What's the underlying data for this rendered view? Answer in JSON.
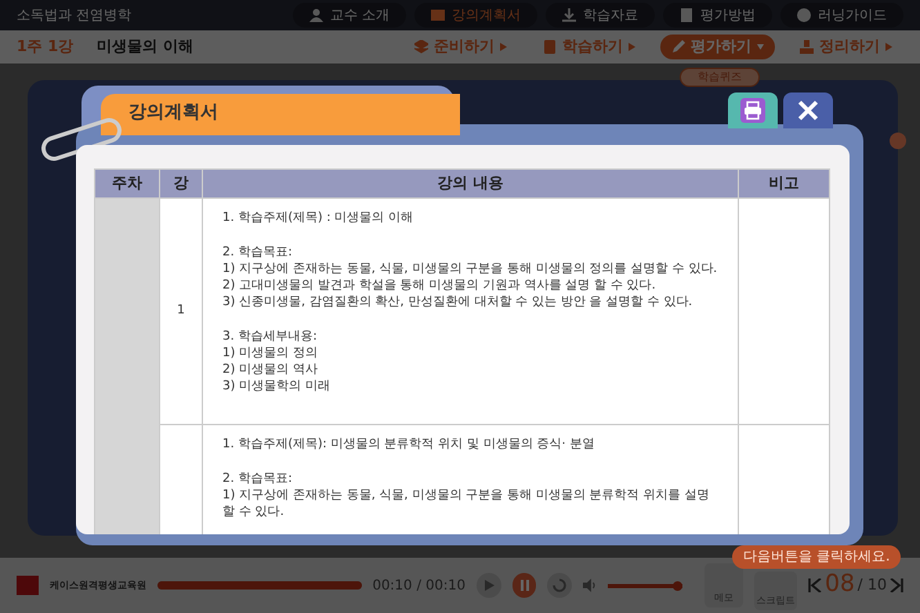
{
  "header": {
    "course_title": "소독법과 전염병학",
    "nav": [
      {
        "label": "교수 소개",
        "selected": false
      },
      {
        "label": "강의계획서",
        "selected": true
      },
      {
        "label": "학습자료",
        "selected": false
      },
      {
        "label": "평가방법",
        "selected": false
      },
      {
        "label": "러닝가이드",
        "selected": false
      }
    ]
  },
  "lesson_bar": {
    "lesson": "1주 1강",
    "title": "미생물의 이해",
    "steps": [
      {
        "label": "준비하기",
        "selected": false
      },
      {
        "label": "학습하기",
        "selected": false
      },
      {
        "label": "평가하기",
        "selected": true
      },
      {
        "label": "정리하기",
        "selected": false
      }
    ],
    "step_popup": "학습퀴즈"
  },
  "modal": {
    "title": "강의계획서",
    "table": {
      "columns": [
        "주차",
        "강",
        "강의 내용",
        "비고"
      ],
      "rows": [
        {
          "lecture": "1",
          "paragraphs": [
            [
              "1. 학습주제(제목) : 미생물의 이해"
            ],
            [
              "2. 학습목표:",
              "1) 지구상에 존재하는 동물, 식물, 미생물의 구분을 통해 미생물의 정의를 설명할 수 있다.",
              "2) 고대미생물의 발견과 학설을 통해 미생물의 기원과 역사를 설명 할 수 있다.",
              "3) 신종미생물, 감염질환의 확산, 만성질환에 대처할 수 있는 방안 을 설명할 수 있다."
            ],
            [
              "3. 학습세부내용:",
              "1) 미생물의 정의",
              "2) 미생물의 역사",
              "3) 미생물학의 미래"
            ]
          ]
        },
        {
          "paragraphs": [
            [
              "1. 학습주제(제목): 미생물의 분류학적 위치 및 미생물의 증식· 분열"
            ],
            [
              "2. 학습목표:",
              "1) 지구상에 존재하는 동물, 식물, 미생물의 구분을 통해 미생물의 분류학적 위치를 설명할 수 있다."
            ]
          ]
        }
      ]
    }
  },
  "player": {
    "logo": "케이스원격평생교육원",
    "progress": {
      "level": 1
    },
    "time": "00:10 / 00:10",
    "volume": {
      "level": 1
    },
    "hint": "다음버튼을 클릭하세요.",
    "memo": "메모",
    "script": "스크립트",
    "page_current": "08",
    "page_total": "/ 10"
  }
}
